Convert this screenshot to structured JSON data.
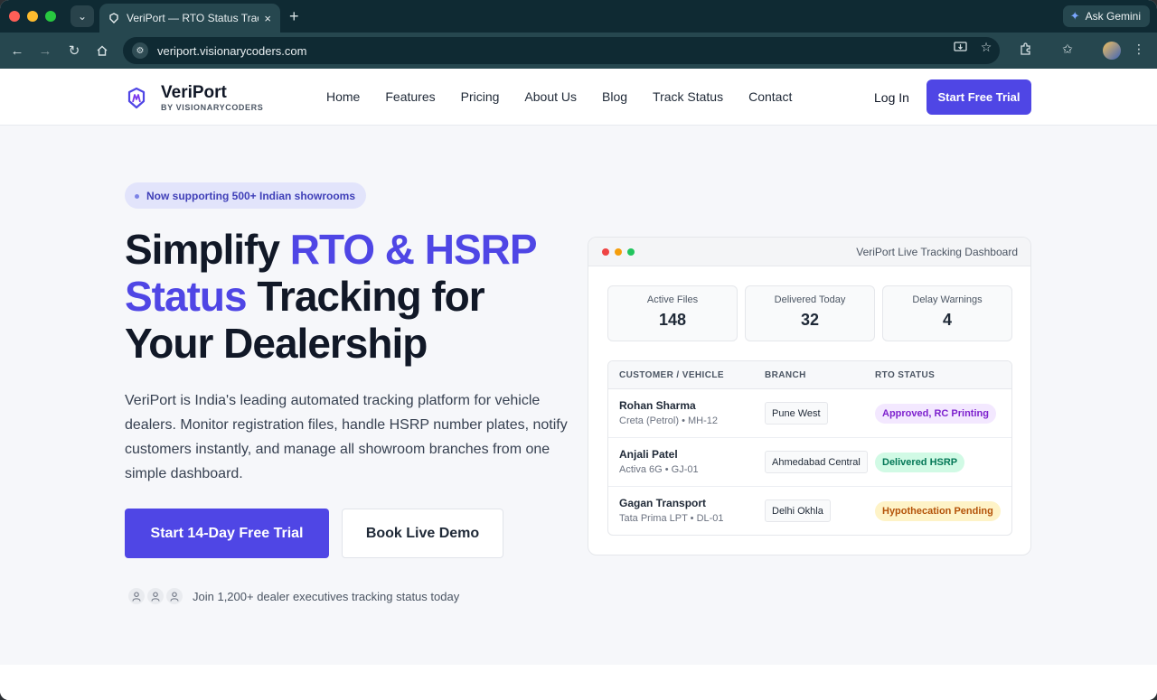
{
  "browser": {
    "tab_title": "VeriPort — RTO Status Tracking",
    "tab_close": "×",
    "new_tab": "+",
    "gemini_label": "Ask Gemini",
    "url": "veriport.visionarycoders.com",
    "icons": [
      "back-icon",
      "forward-icon",
      "reload-icon",
      "home-icon",
      "site-info-icon",
      "install-icon",
      "bookmark-star-icon",
      "extensions-icon",
      "bookmarks-icon",
      "profile-icon",
      "menu-icon"
    ]
  },
  "nav": {
    "logo_name": "VeriPort",
    "logo_sub": "BY VISIONARYCODERS",
    "links": [
      "Home",
      "Features",
      "Pricing",
      "About Us",
      "Blog",
      "Track Status",
      "Contact"
    ],
    "login": "Log In",
    "cta": "Start Free Trial"
  },
  "hero": {
    "pill": "Now supporting 500+ Indian showrooms",
    "headline_1": "Simplify ",
    "headline_accent": "RTO & HSRP Status",
    "headline_2": " Tracking for Your Dealership",
    "lead": "VeriPort is India's leading automated tracking platform for vehicle dealers. Monitor registration files, handle HSRP number plates, notify customers instantly, and manage all showroom branches from one simple dashboard.",
    "primary_cta": "Start 14-Day Free Trial",
    "secondary_cta": "Book Live Demo",
    "social_proof": "Join 1,200+ dealer executives tracking status today"
  },
  "dashboard": {
    "title": "VeriPort Live Tracking Dashboard",
    "stats": [
      {
        "label": "Active Files",
        "value": "148"
      },
      {
        "label": "Delivered Today",
        "value": "32"
      },
      {
        "label": "Delay Warnings",
        "value": "4"
      }
    ],
    "columns": [
      "CUSTOMER / VEHICLE",
      "BRANCH",
      "RTO STATUS"
    ],
    "rows": [
      {
        "name": "Rohan Sharma",
        "vehicle": "Creta (Petrol) • MH-12",
        "branch": "Pune West",
        "status": "Approved, RC Printing"
      },
      {
        "name": "Anjali Patel",
        "vehicle": "Activa 6G • GJ-01",
        "branch": "Ahmedabad Central",
        "status": "Delivered HSRP"
      },
      {
        "name": "Gagan Transport",
        "vehicle": "Tata Prima LPT • DL-01",
        "branch": "Delhi Okhla",
        "status": "Hypothecation Pending"
      }
    ]
  },
  "colors": {
    "brand": "#4f46e5",
    "status_purple": "#7e22ce",
    "status_green": "#047857",
    "status_amber": "#b45309"
  }
}
